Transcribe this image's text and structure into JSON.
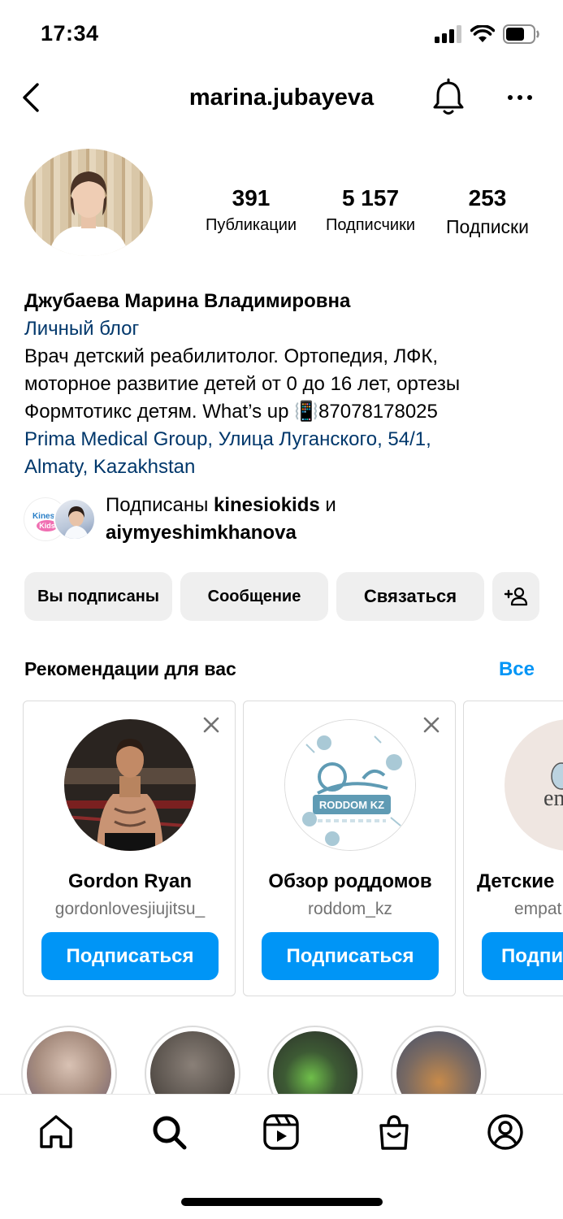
{
  "status_bar": {
    "time": "17:34"
  },
  "header": {
    "username": "marina.jubayeva"
  },
  "profile": {
    "stats": [
      {
        "value": "391",
        "label": "Публикации"
      },
      {
        "value": "5 157",
        "label": "Подписчики"
      },
      {
        "value": "253",
        "label": "Подписки"
      }
    ],
    "name": "Джубаева Марина Владимировна",
    "category": "Личный блог",
    "bio_line1": "Врач детский реабилитолог. Ортопедия, ЛФК,",
    "bio_line2": "моторное развитие детей от 0 до 16 лет, ортезы",
    "bio_line3_a": "Формтотикс детям. What’s up ",
    "bio_emoji": "📳",
    "bio_line3_b": "87078178025",
    "location_line1": "Prima Medical Group, Улица Луганского, 54/1,",
    "location_line2": "Almaty, Kazakhstan",
    "followed_prefix": "Подписаны ",
    "followed_user1": "kinesiokids",
    "followed_mid": " и",
    "followed_user2": "aiymyeshimkhanova",
    "kinesio_logo_text1": "Kinesio",
    "kinesio_logo_text2": "Kids"
  },
  "actions": {
    "following": "Вы подписаны",
    "message": "Сообщение",
    "contact": "Связаться"
  },
  "suggestions": {
    "title": "Рекомендации для вас",
    "see_all": "Все",
    "cards": [
      {
        "name": "Gordon Ryan",
        "username": "gordonlovesjiujitsu_",
        "button": "Подписаться"
      },
      {
        "name": "Обзор роддомов",
        "username": "roddom_kz",
        "button": "Подписаться",
        "logo_text": "RODDOM KZ"
      },
      {
        "name": "Детские",
        "username": "empat",
        "button": "Подпи",
        "logo_text": "emp"
      }
    ]
  },
  "colors": {
    "accent": "#0095f6",
    "link": "#00376b",
    "button_bg": "#efefef"
  },
  "tabbar": [
    "home-icon",
    "search-icon",
    "reels-icon",
    "shop-icon",
    "profile-icon"
  ]
}
